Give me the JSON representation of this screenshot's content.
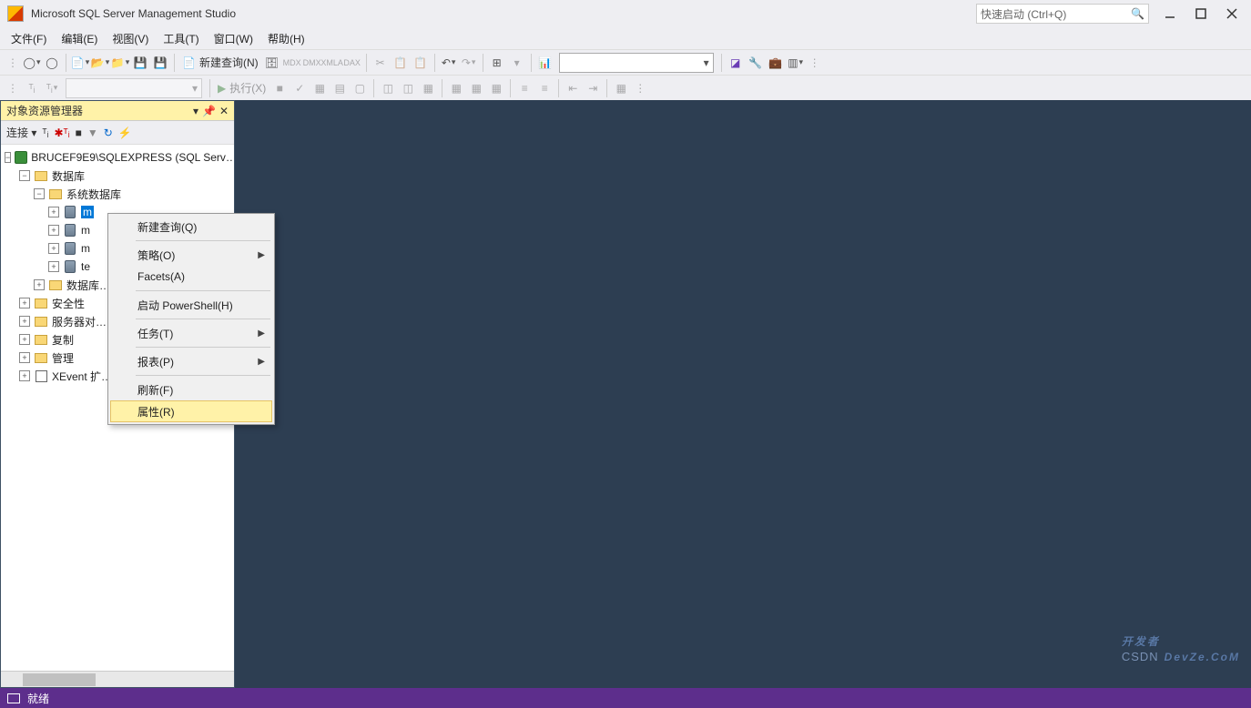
{
  "title": "Microsoft SQL Server Management Studio",
  "quick_launch_placeholder": "快速启动 (Ctrl+Q)",
  "menu": {
    "file": "文件(F)",
    "edit": "编辑(E)",
    "view": "视图(V)",
    "tools": "工具(T)",
    "window": "窗口(W)",
    "help": "帮助(H)"
  },
  "toolbar": {
    "new_query": "新建查询(N)",
    "execute": "执行(X)"
  },
  "object_explorer": {
    "title": "对象资源管理器",
    "connect": "连接",
    "server": "BRUCEF9E9\\SQLEXPRESS (SQL Serv…",
    "databases": "数据库",
    "system_dbs": "系统数据库",
    "db_master_prefix": "m",
    "db_model": "m",
    "db_msdb": "m",
    "db_tempdb": "te",
    "db_snapshots": "数据库…",
    "security": "安全性",
    "server_objects": "服务器对…",
    "replication": "复制",
    "management": "管理",
    "xevent": "XEvent 扩…"
  },
  "context_menu": {
    "new_query": "新建查询(Q)",
    "policy": "策略(O)",
    "facets": "Facets(A)",
    "powershell": "启动 PowerShell(H)",
    "tasks": "任务(T)",
    "reports": "报表(P)",
    "refresh": "刷新(F)",
    "properties": "属性(R)"
  },
  "status": {
    "ready": "就绪"
  },
  "watermark": {
    "prefix": "CSDN",
    "main": "开发者",
    "sub": "DevZe.CoM"
  }
}
